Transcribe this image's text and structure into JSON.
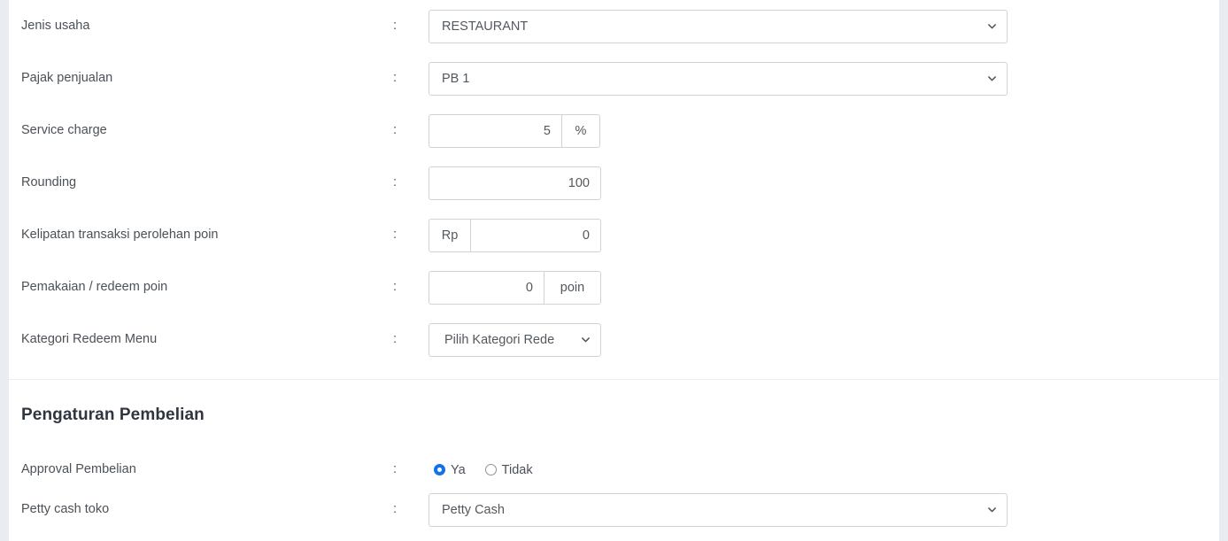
{
  "colors": {
    "page_background": "#e9ecf1",
    "card_background": "#ffffff",
    "label_text": "#4b5157",
    "heading_text": "#2f3640",
    "control_border": "#ced4da",
    "radio_accent": "#1272e8"
  },
  "separator": ":",
  "sections": [
    {
      "id": "sales-settings",
      "heading": null,
      "rows": [
        {
          "label": "Jenis usaha",
          "control": {
            "type": "select",
            "value": "RESTAURANT",
            "icon": "chevron-down-icon"
          }
        },
        {
          "label": "Pajak penjualan",
          "control": {
            "type": "select",
            "value": "PB 1",
            "icon": "chevron-down-icon"
          }
        },
        {
          "label": "Service charge",
          "control": {
            "type": "input-group-suffix",
            "value": "5",
            "suffix": "%"
          }
        },
        {
          "label": "Rounding",
          "control": {
            "type": "input",
            "value": "100"
          }
        },
        {
          "label": "Kelipatan transaksi perolehan poin",
          "control": {
            "type": "input-group-prefix",
            "prefix": "Rp",
            "value": "0"
          }
        },
        {
          "label": "Pemakaian / redeem poin",
          "control": {
            "type": "input-group-suffix",
            "value": "0",
            "suffix": "poin"
          }
        },
        {
          "label": "Kategori Redeem Menu",
          "control": {
            "type": "select-narrow",
            "value": "Pilih Kategori Rede",
            "icon": "chevron-down-icon"
          }
        }
      ]
    },
    {
      "id": "purchase-settings",
      "heading": "Pengaturan Pembelian",
      "rows": [
        {
          "label": "Approval Pembelian",
          "control": {
            "type": "radio-group",
            "options": [
              {
                "label": "Ya",
                "selected": true
              },
              {
                "label": "Tidak",
                "selected": false
              }
            ]
          }
        },
        {
          "label": "Petty cash toko",
          "control": {
            "type": "select",
            "value": "Petty Cash",
            "icon": "chevron-down-icon"
          }
        }
      ]
    }
  ]
}
